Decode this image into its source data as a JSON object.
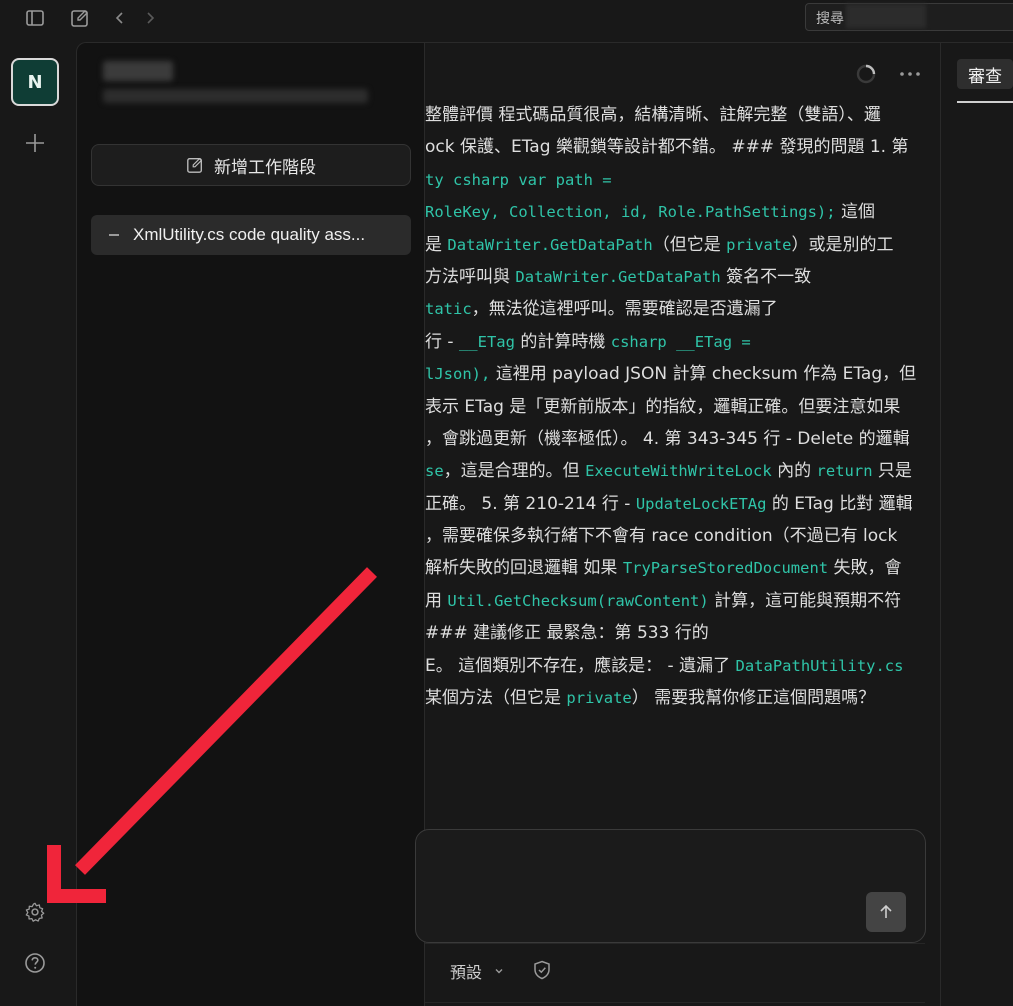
{
  "search": {
    "label": "搜尋"
  },
  "rail": {
    "workspace_initial": "N"
  },
  "sessions": {
    "new_session_label": "新增工作階段",
    "items": [
      {
        "label": "XmlUtility.cs code quality ass..."
      }
    ]
  },
  "message_lines": [
    [
      {
        "t": "整體評價 程式碼品質很高，結構清晰、註解完整（雙語）、邏"
      }
    ],
    [
      {
        "t": "ock 保護、ETag 樂觀鎖等設計都不錯。 ### 發現的問題 1. 第"
      }
    ],
    [
      {
        "c": "ty csharp var path ="
      }
    ],
    [
      {
        "c": "RoleKey, Collection, id, Role.PathSettings);"
      },
      {
        "t": " 這個"
      }
    ],
    [
      {
        "t": "是 "
      },
      {
        "c": "DataWriter.GetDataPath"
      },
      {
        "t": "（但它是 "
      },
      {
        "c": "private"
      },
      {
        "t": "）或是別的工"
      }
    ],
    [
      {
        "t": "方法呼叫與 "
      },
      {
        "c": "DataWriter.GetDataPath"
      },
      {
        "t": " 簽名不一致"
      }
    ],
    [
      {
        "c": "tatic"
      },
      {
        "t": "，無法從這裡呼叫。需要確認是否遺漏了"
      }
    ],
    [
      {
        "t": "行 - "
      },
      {
        "c": "__ETag"
      },
      {
        "t": " 的計算時機 "
      },
      {
        "c": "csharp __ETag ="
      }
    ],
    [
      {
        "c": "lJson),"
      },
      {
        "t": " 這裡用 payload JSON 計算 checksum 作為 ETag，但"
      }
    ],
    [
      {
        "t": "表示 ETag 是「更新前版本」的指紋，邏輯正確。但要注意如果"
      }
    ],
    [
      {
        "t": "，會跳過更新（機率極低）。 4. 第 343-345 行 - Delete 的邏輯"
      }
    ],
    [
      {
        "c": "se"
      },
      {
        "t": "，這是合理的。但 "
      },
      {
        "c": "ExecuteWithWriteLock"
      },
      {
        "t": " 內的 "
      },
      {
        "c": "return"
      },
      {
        "t": " 只是"
      }
    ],
    [
      {
        "t": "正確。 5. 第 210-214 行 - "
      },
      {
        "c": "UpdateLockETAg"
      },
      {
        "t": " 的 ETag 比對 邏輯"
      }
    ],
    [
      {
        "t": "，需要確保多執行緒下不會有 race condition（不過已有 lock"
      }
    ],
    [
      {
        "t": "解析失敗的回退邏輯 如果 "
      },
      {
        "c": "TryParseStoredDocument"
      },
      {
        "t": " 失敗，會"
      }
    ],
    [
      {
        "t": "用 "
      },
      {
        "c": "Util.GetChecksum(rawContent)"
      },
      {
        "t": " 計算，這可能與預期不符"
      }
    ],
    [
      {
        "t": "### 建議修正 最緊急：第 533 行的"
      }
    ],
    [
      {
        "t": "E。 這個類別不存在，應該是： - 遺漏了 "
      },
      {
        "c": "DataPathUtility.cs"
      }
    ],
    [
      {
        "t": "某個方法（但它是 "
      },
      {
        "c": "private"
      },
      {
        "t": "） 需要我幫你修正這個問題嗎？"
      }
    ]
  ],
  "composer": {
    "model_label": "預設"
  },
  "right_panel": {
    "tab_label": "審查"
  },
  "colors": {
    "code": "#2fc4a8",
    "annotation_arrow": "#f0253a",
    "workspace_bg": "#0f3d35"
  }
}
